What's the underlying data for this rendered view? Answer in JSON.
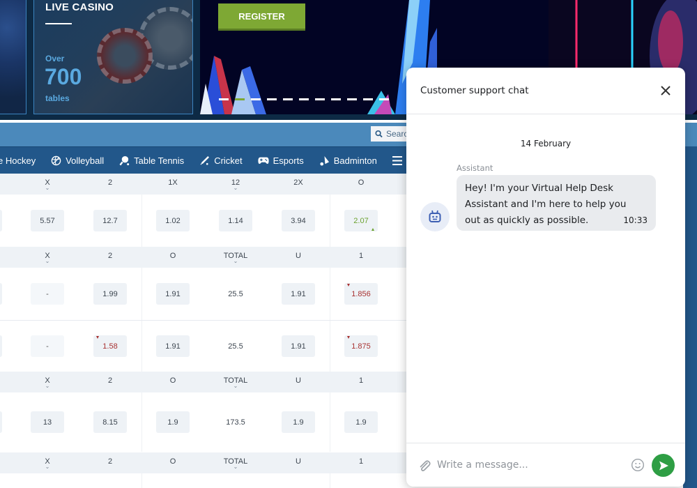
{
  "banner": {
    "live_casino": {
      "title": "LIVE CASINO",
      "over": "Over",
      "count": "700",
      "unit": "tables"
    },
    "register_label": "REGISTER",
    "slides": 8,
    "active_slide": 1
  },
  "search": {
    "placeholder": "Search"
  },
  "sports_nav": {
    "items": [
      {
        "label": "Ice Hockey",
        "visible_label": "e Hockey",
        "icon": "hockey-icon"
      },
      {
        "label": "Volleyball",
        "icon": "volleyball-icon"
      },
      {
        "label": "Table Tennis",
        "icon": "table-tennis-icon"
      },
      {
        "label": "Cricket",
        "icon": "cricket-icon"
      },
      {
        "label": "Esports",
        "icon": "gamepad-icon"
      },
      {
        "label": "Badminton",
        "icon": "shuttlecock-icon"
      }
    ],
    "menu_icon": "menu-icon"
  },
  "odds_table": {
    "sections": [
      {
        "headers": [
          {
            "label": "X",
            "sortable": true
          },
          {
            "label": "2"
          },
          {
            "label": "1X"
          },
          {
            "label": "12",
            "sortable": true
          },
          {
            "label": "2X"
          },
          {
            "label": "O"
          }
        ],
        "rows": [
          [
            "5.57",
            "12.7",
            "1.02",
            "1.14",
            "3.94",
            {
              "value": "2.07",
              "trend": "up"
            }
          ]
        ]
      },
      {
        "headers": [
          {
            "label": "X",
            "sortable": true
          },
          {
            "label": "2"
          },
          {
            "label": "O"
          },
          {
            "label": "TOTAL",
            "sortable": true
          },
          {
            "label": "U"
          },
          {
            "label": "1"
          }
        ],
        "rows": [
          [
            "-",
            "1.99",
            "1.91",
            "25.5",
            "1.91",
            {
              "value": "1.856",
              "trend": "down"
            }
          ],
          [
            "-",
            {
              "value": "1.58",
              "trend": "down"
            },
            "1.91",
            "25.5",
            "1.91",
            {
              "value": "1.875",
              "trend": "down"
            }
          ]
        ]
      },
      {
        "headers": [
          {
            "label": "X",
            "sortable": true
          },
          {
            "label": "2"
          },
          {
            "label": "O"
          },
          {
            "label": "TOTAL",
            "sortable": true
          },
          {
            "label": "U"
          },
          {
            "label": "1"
          }
        ],
        "rows": [
          [
            "13",
            "8.15",
            "1.9",
            "173.5",
            "1.9",
            "1.9"
          ]
        ]
      },
      {
        "headers": [
          {
            "label": "X",
            "sortable": true
          },
          {
            "label": "2"
          },
          {
            "label": "O"
          },
          {
            "label": "TOTAL",
            "sortable": true
          },
          {
            "label": "U"
          },
          {
            "label": "1"
          }
        ],
        "rows": []
      }
    ]
  },
  "chat": {
    "title": "Customer support chat",
    "date": "14 February",
    "messages": [
      {
        "sender": "Assistant",
        "text": "Hey! I'm your Virtual Help Desk Assistant and I'm here to help you out as quickly as possible.",
        "time": "10:33"
      }
    ],
    "input": {
      "value": "",
      "placeholder": "Write a message..."
    }
  },
  "colors": {
    "brand_blue": "#22578a",
    "search_bar": "#4b89bb",
    "register_green": "#7ea834",
    "odd_up": "#6ba22f",
    "odd_down": "#a83232",
    "send_green": "#2e9e44",
    "casino_accent": "#5aa9e0"
  }
}
